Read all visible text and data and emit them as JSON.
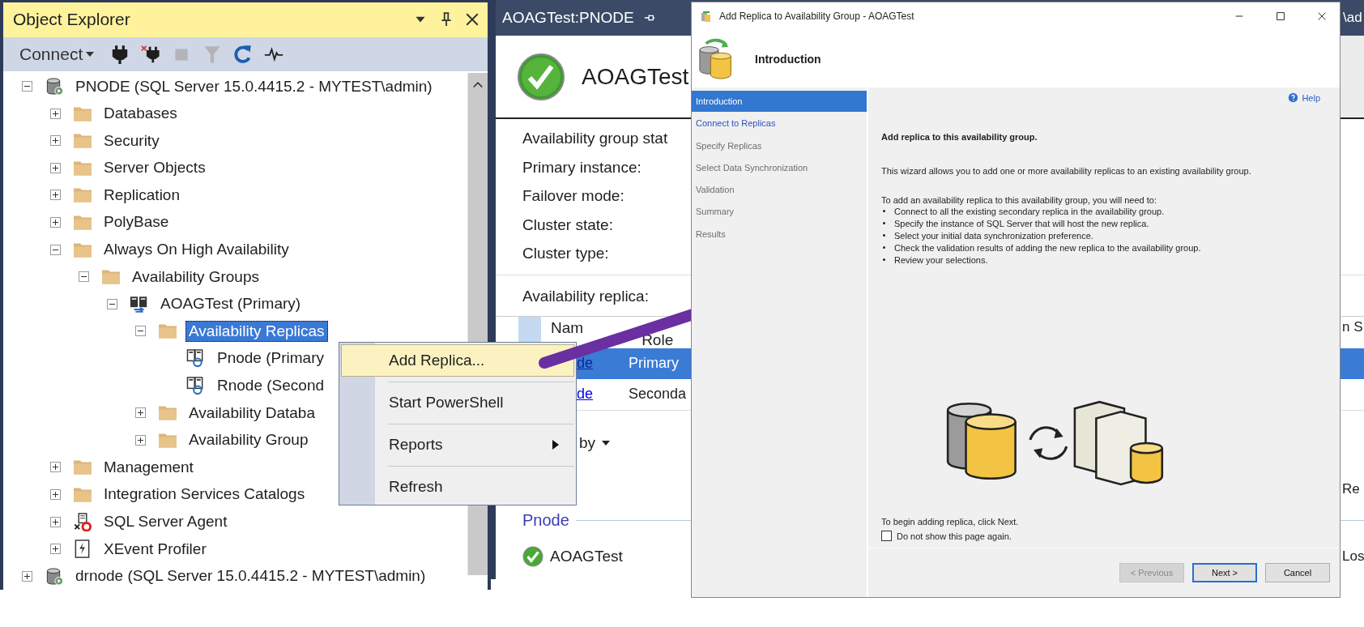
{
  "explorer": {
    "title": "Object Explorer",
    "connect_label": "Connect",
    "tree": [
      {
        "label": "PNODE (SQL Server 15.0.4415.2 - MYTEST\\admin)",
        "kind": "server",
        "expanded": true,
        "selected": false,
        "children": [
          {
            "label": "Databases",
            "kind": "folder",
            "expanded": false,
            "selected": false
          },
          {
            "label": "Security",
            "kind": "folder",
            "expanded": false,
            "selected": false
          },
          {
            "label": "Server Objects",
            "kind": "folder",
            "expanded": false,
            "selected": false
          },
          {
            "label": "Replication",
            "kind": "folder",
            "expanded": false,
            "selected": false
          },
          {
            "label": "PolyBase",
            "kind": "folder",
            "expanded": false,
            "selected": false
          },
          {
            "label": "Always On High Availability",
            "kind": "folder",
            "expanded": true,
            "selected": false,
            "children": [
              {
                "label": "Availability Groups",
                "kind": "folder",
                "expanded": true,
                "selected": false,
                "children": [
                  {
                    "label": "AOAGTest (Primary)",
                    "kind": "group",
                    "expanded": true,
                    "selected": false,
                    "children": [
                      {
                        "label": "Availability Replicas",
                        "kind": "folder",
                        "expanded": true,
                        "selected": true,
                        "children": [
                          {
                            "label": "Pnode (Primary",
                            "kind": "replica",
                            "selected": false
                          },
                          {
                            "label": "Rnode (Second",
                            "kind": "replica",
                            "selected": false
                          }
                        ]
                      },
                      {
                        "label": "Availability Databa",
                        "kind": "folder",
                        "expanded": false,
                        "selected": false
                      },
                      {
                        "label": "Availability Group",
                        "kind": "folder",
                        "expanded": false,
                        "selected": false
                      }
                    ]
                  }
                ]
              }
            ]
          },
          {
            "label": "Management",
            "kind": "folder",
            "expanded": false,
            "selected": false
          },
          {
            "label": "Integration Services Catalogs",
            "kind": "folder",
            "expanded": false,
            "selected": false
          },
          {
            "label": "SQL Server Agent",
            "kind": "agent",
            "expanded": false,
            "selected": false
          },
          {
            "label": "XEvent Profiler",
            "kind": "xevent",
            "expanded": false,
            "selected": false
          }
        ]
      },
      {
        "label": "drnode (SQL Server 15.0.4415.2 - MYTEST\\admin)",
        "kind": "server",
        "expanded": false,
        "selected": false
      }
    ]
  },
  "document": {
    "tab_title": "AOAGTest:PNODE",
    "title_fragment": "\\ad",
    "heading": "AOAGTest",
    "properties": [
      "Availability group stat",
      "Primary instance:",
      "Failover mode:",
      "Cluster state:",
      "Cluster type:"
    ],
    "replica_label": "Availability replica:",
    "columns": [
      "Nam",
      "Role"
    ],
    "column_fragment": "n S",
    "rows": [
      {
        "name": "de",
        "role": "Primary",
        "selected": true
      },
      {
        "name": "de",
        "role": "Seconda",
        "selected": false
      }
    ],
    "group_by": "by",
    "fragment_1": "Re",
    "group": "Pnode",
    "group_item": "AOAGTest",
    "fragment_2": "Los"
  },
  "context_menu": {
    "items": [
      {
        "label": "Add Replica...",
        "selected": true,
        "submenu": false
      },
      {
        "label": "Start PowerShell",
        "selected": false,
        "submenu": false
      },
      {
        "label": "Reports",
        "selected": false,
        "submenu": true
      },
      {
        "label": "Refresh",
        "selected": false,
        "submenu": false
      }
    ]
  },
  "dialog": {
    "title": "Add Replica to Availability Group - AOAGTest",
    "page_title": "Introduction",
    "nav": [
      {
        "label": "Introduction",
        "selected": true,
        "enabled": true
      },
      {
        "label": "Connect to Replicas",
        "selected": false,
        "enabled": true
      },
      {
        "label": "Specify Replicas",
        "selected": false,
        "enabled": false
      },
      {
        "label": "Select Data Synchronization",
        "selected": false,
        "enabled": false
      },
      {
        "label": "Validation",
        "selected": false,
        "enabled": false
      },
      {
        "label": "Summary",
        "selected": false,
        "enabled": false
      },
      {
        "label": "Results",
        "selected": false,
        "enabled": false
      }
    ],
    "help": "Help",
    "heading": "Add replica to this availability group.",
    "description": "This wizard allows you to add one or more availability replicas to an existing availability group.",
    "steps_intro": "To add an availability replica to this availability group, you will need to:",
    "steps": [
      "Connect to all the existing secondary replica in the availability group.",
      "Specify the instance of SQL Server that will host the new replica.",
      "Select your initial data synchronization preference.",
      "Check the validation results of adding the new replica to the availability group.",
      "Review your selections."
    ],
    "begin_text": "To begin adding replica, click Next.",
    "checkbox": {
      "label": "Do not show this page again.",
      "checked": false
    },
    "buttons": [
      {
        "label": "< Previous",
        "disabled": true,
        "default": false
      },
      {
        "label": "Next >",
        "disabled": false,
        "default": true
      },
      {
        "label": "Cancel",
        "disabled": false,
        "default": false
      }
    ]
  }
}
